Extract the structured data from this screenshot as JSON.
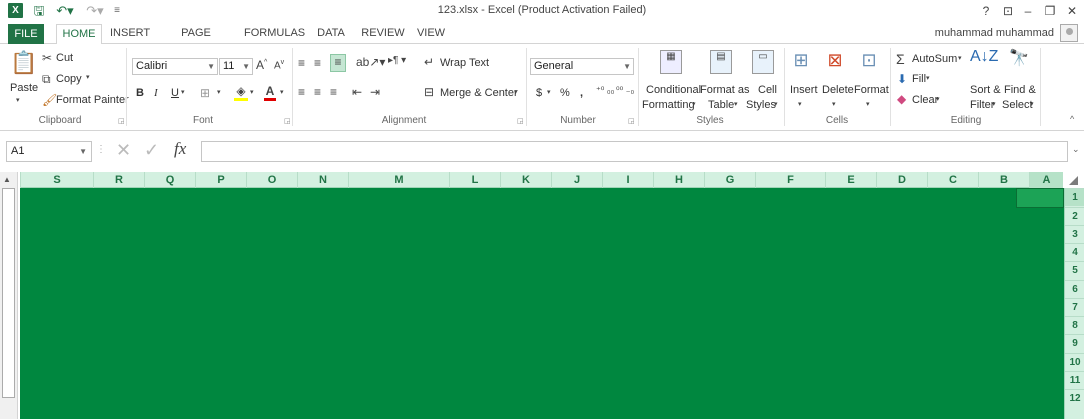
{
  "window": {
    "title": "123.xlsx - Excel (Product Activation Failed)",
    "app_icon": "X",
    "controls": [
      "?",
      "⊡",
      "–",
      "❐",
      "✕"
    ]
  },
  "tabs": [
    "FILE",
    "HOME",
    "INSERT",
    "PAGE LAYOUT",
    "FORMULAS",
    "DATA",
    "REVIEW",
    "VIEW"
  ],
  "user": "muhammad muhammad",
  "ribbon": {
    "clipboard": {
      "paste": "Paste",
      "cut": "Cut",
      "copy": "Copy",
      "format_painter": "Format Painter",
      "label": "Clipboard"
    },
    "font": {
      "name": "Calibri",
      "size": "11",
      "bold": "B",
      "italic": "I",
      "underline": "U",
      "label": "Font"
    },
    "alignment": {
      "wrap_text": "Wrap Text",
      "merge_center": "Merge & Center",
      "label": "Alignment"
    },
    "number": {
      "format": "General",
      "currency": "$",
      "percent": "%",
      "comma": ",",
      "label": "Number"
    },
    "styles": {
      "conditional": [
        "Conditional",
        "Formatting"
      ],
      "format_as": [
        "Format as",
        "Table"
      ],
      "cell_styles": [
        "Cell",
        "Styles"
      ],
      "label": "Styles"
    },
    "cells": {
      "insert": "Insert",
      "delete": "Delete",
      "format": "Format",
      "label": "Cells"
    },
    "editing": {
      "autosum": "AutoSum",
      "fill": "Fill",
      "clear": "Clear",
      "sort": [
        "Sort &",
        "Filter"
      ],
      "find": [
        "Find &",
        "Select"
      ],
      "label": "Editing"
    }
  },
  "formula_bar": {
    "name_box": "A1",
    "fx": "fx",
    "value": ""
  },
  "columns": [
    "S",
    "R",
    "Q",
    "P",
    "O",
    "N",
    "M",
    "L",
    "K",
    "J",
    "I",
    "H",
    "G",
    "F",
    "E",
    "D",
    "C",
    "B",
    "A"
  ],
  "rows": [
    "1",
    "2",
    "3",
    "4",
    "5",
    "6",
    "7",
    "8",
    "9",
    "10",
    "11",
    "12"
  ],
  "colors": {
    "excel_green": "#217346",
    "sheet_fill": "#00873f",
    "header_fill": "#d3f0e0"
  }
}
